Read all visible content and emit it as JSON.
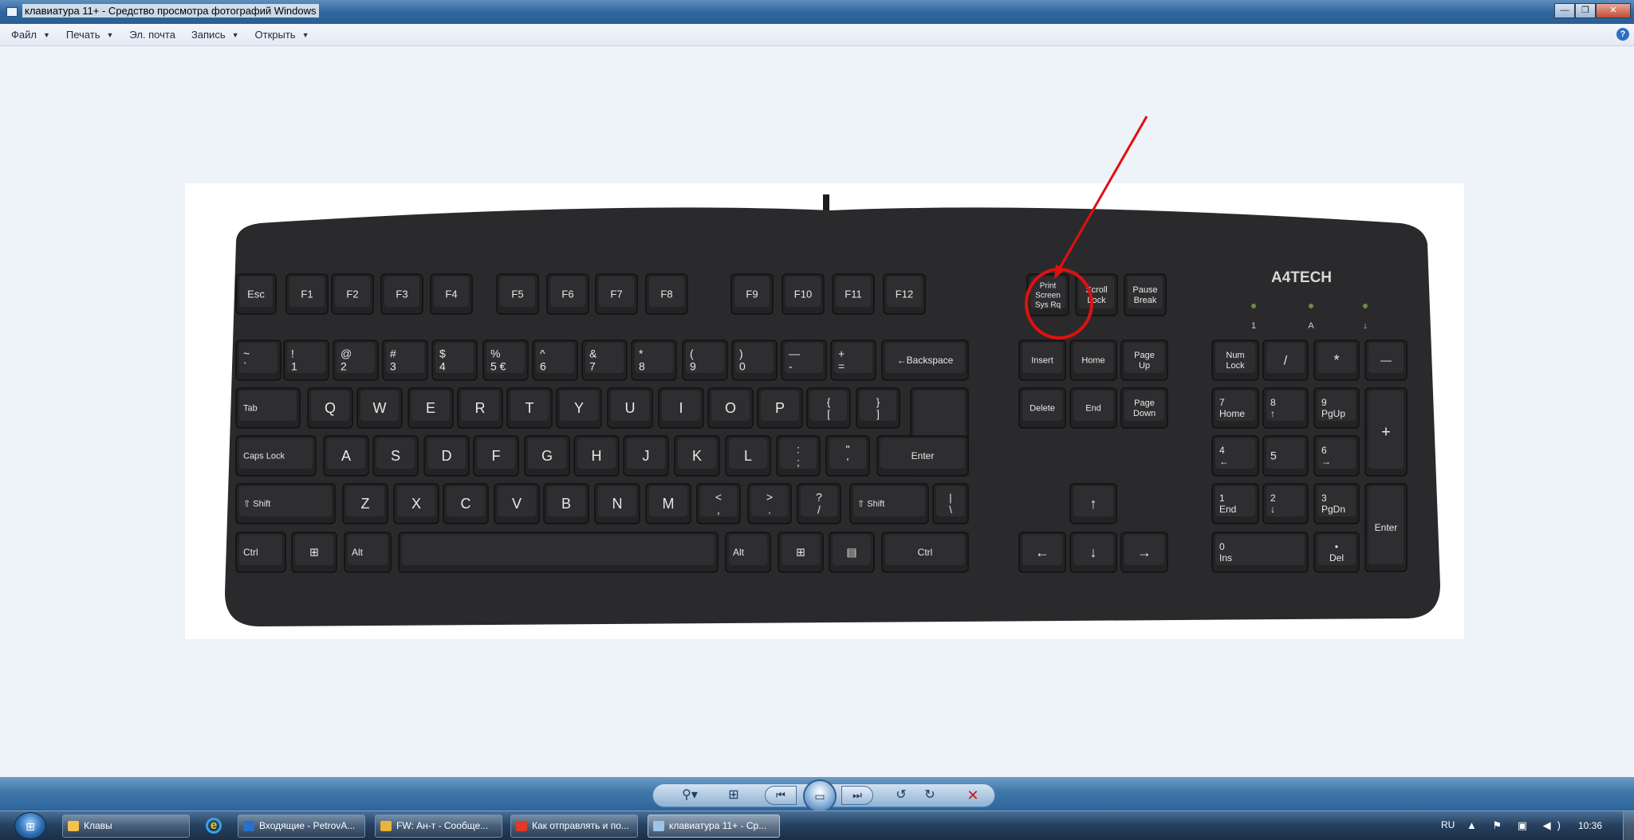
{
  "window": {
    "title": "клавиатура 11+ - Средство просмотра фотографий Windows",
    "minimize": "—",
    "restore": "❐",
    "close": "✕"
  },
  "menubar": {
    "items": [
      {
        "label": "Файл",
        "dropdown": true
      },
      {
        "label": "Печать",
        "dropdown": true
      },
      {
        "label": "Эл. почта",
        "dropdown": false
      },
      {
        "label": "Запись",
        "dropdown": true
      },
      {
        "label": "Открыть",
        "dropdown": true
      }
    ],
    "help": "?"
  },
  "photo": {
    "brand": "A4TECH",
    "highlighted_key": "print-screen-key",
    "highlight_color": "#e01010",
    "keyboard_color": "#2b2b2d",
    "key_color": "#232325",
    "key_label_color": "#e8e8e8",
    "rows": {
      "fn": [
        "Esc",
        "F1",
        "F2",
        "F3",
        "F4",
        "F5",
        "F6",
        "F7",
        "F8",
        "F9",
        "F10",
        "F11",
        "F12"
      ],
      "special": [
        {
          "top": "Print",
          "mid": "Screen",
          "bot": "Sys Rq"
        },
        {
          "top": "Scroll",
          "bot": "Lock"
        },
        {
          "top": "Pause",
          "bot": "Break"
        }
      ],
      "indicators": [
        "1",
        "A",
        "↓"
      ],
      "number": [
        {
          "t": "~",
          "b": "`"
        },
        {
          "t": "!",
          "b": "1"
        },
        {
          "t": "@",
          "b": "2"
        },
        {
          "t": "#",
          "b": "3"
        },
        {
          "t": "$",
          "b": "4"
        },
        {
          "t": "%",
          "b": "5 €"
        },
        {
          "t": "^",
          "b": "6"
        },
        {
          "t": "&",
          "b": "7"
        },
        {
          "t": "*",
          "b": "8"
        },
        {
          "t": "(",
          "b": "9"
        },
        {
          "t": ")",
          "b": "0"
        },
        {
          "t": "—",
          "b": "-"
        },
        {
          "t": "+",
          "b": "="
        }
      ],
      "backspace": "←Backspace",
      "tab": "Tab",
      "qwerty": [
        "Q",
        "W",
        "E",
        "R",
        "T",
        "Y",
        "U",
        "I",
        "O",
        "P"
      ],
      "bracket_open": {
        "t": "{",
        "b": "["
      },
      "bracket_close": {
        "t": "}",
        "b": "]"
      },
      "caps": "Caps Lock",
      "asdf": [
        "A",
        "S",
        "D",
        "F",
        "G",
        "H",
        "J",
        "K",
        "L"
      ],
      "semicolon": {
        "t": ":",
        "b": ";"
      },
      "quote": {
        "t": "\"",
        "b": "'"
      },
      "enter": "Enter",
      "shift": "⇧ Shift",
      "zxcv": [
        "Z",
        "X",
        "C",
        "V",
        "B",
        "N",
        "M"
      ],
      "comma": {
        "t": "<",
        "b": ","
      },
      "period": {
        "t": ">",
        "b": "."
      },
      "slash": {
        "t": "?",
        "b": "/"
      },
      "backslash": {
        "t": "|",
        "b": "\\"
      },
      "ctrl": "Ctrl",
      "alt": "Alt",
      "nav": [
        "Insert",
        "Home",
        "Page Up",
        "Delete",
        "End",
        "Page Down"
      ],
      "arrows": {
        "up": "↑",
        "left": "←",
        "down": "↓",
        "right": "→"
      },
      "numpad": {
        "numlock": "Num Lock",
        "divide": "/",
        "multiply": "*",
        "minus": "—",
        "plus": "+",
        "enter": "Enter",
        "n7": {
          "t": "7",
          "b": "Home"
        },
        "n8": {
          "t": "8",
          "b": "↑"
        },
        "n9": {
          "t": "9",
          "b": "PgUp"
        },
        "n4": {
          "t": "4",
          "b": "←"
        },
        "n5": {
          "t": "5",
          "b": ""
        },
        "n6": {
          "t": "6",
          "b": "→"
        },
        "n1": {
          "t": "1",
          "b": "End"
        },
        "n2": {
          "t": "2",
          "b": "↓"
        },
        "n3": {
          "t": "3",
          "b": "PgDn"
        },
        "n0": {
          "t": "0",
          "b": "Ins"
        },
        "dot": {
          "t": "•",
          "b": "Del"
        }
      }
    }
  },
  "controls": {
    "zoom": "⚲▾",
    "fit": "⊞",
    "prev": "⏮",
    "slideshow": "▭",
    "next": "⏭",
    "rotate_left": "↺",
    "rotate_right": "↻",
    "delete": "✕"
  },
  "taskbar": {
    "start": "⊞",
    "tasks": [
      {
        "label": "Клавы",
        "color": "#f2c14e"
      },
      {
        "label": "Входящие - PetrovA...",
        "color": "#2a6fc9"
      },
      {
        "label": "FW: Ан-т - Сообще...",
        "color": "#e8b53a"
      },
      {
        "label": "Как отправлять и по...",
        "color": "#e2392a"
      },
      {
        "label": "клавиатура 11+ - Ср...",
        "color": "#9cc4ea"
      }
    ],
    "ie": "e",
    "lang": "RU",
    "tray_icons": "▲ ⚑ ▣ ◀)",
    "clock": "10:36"
  }
}
